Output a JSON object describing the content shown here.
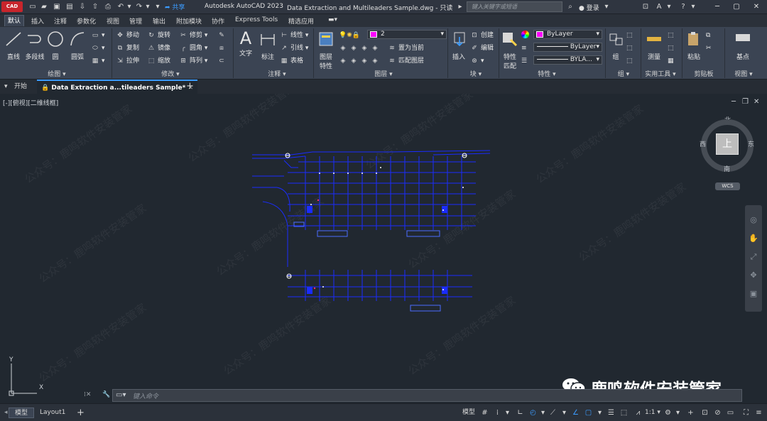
{
  "titlebar": {
    "logo_text": "CAD",
    "share_label": "共享",
    "app_title": "Autodesk AutoCAD 2023",
    "doc_title": "Data Extraction and Multileaders Sample.dwg - 只读",
    "search_placeholder": "键入关键字或短语",
    "login_label": "登录"
  },
  "ribbon_tabs": [
    "默认",
    "插入",
    "注释",
    "参数化",
    "视图",
    "管理",
    "输出",
    "附加模块",
    "协作",
    "Express Tools",
    "精选应用"
  ],
  "ribbon": {
    "draw": {
      "title": "绘图",
      "line": "直线",
      "polyline": "多段线",
      "circle": "圆",
      "arc": "圆弧"
    },
    "modify": {
      "title": "修改",
      "move": "移动",
      "rotate": "旋转",
      "trim": "修剪",
      "copy": "复制",
      "mirror": "镜像",
      "fillet": "圆角",
      "stretch": "拉伸",
      "scale": "缩放",
      "array": "阵列"
    },
    "annotation": {
      "title": "注释",
      "text": "文字",
      "dimension": "标注",
      "linear": "线性",
      "leader": "引线",
      "table": "表格"
    },
    "layers": {
      "title": "图层",
      "layer_props_line1": "图层",
      "layer_props_line2": "特性",
      "current_layer": "2",
      "make_current": "置为当前",
      "match_layer": "匹配图层"
    },
    "block": {
      "title": "块",
      "insert": "插入",
      "create": "创建",
      "edit": "编辑"
    },
    "properties": {
      "title": "特性",
      "match_line1": "特性",
      "match_line2": "匹配",
      "color": "ByLayer",
      "linetype": "ByLayer",
      "lineweight": "BYLA..."
    },
    "groups": {
      "title": "组",
      "group": "组"
    },
    "utilities": {
      "title": "实用工具",
      "measure": "测量"
    },
    "clipboard": {
      "title": "剪贴板",
      "paste": "粘贴"
    },
    "view": {
      "title": "视图",
      "base": "基点"
    }
  },
  "doc_tabs": {
    "start": "开始",
    "active": "Data Extraction a...tileaders Sample*"
  },
  "viewport": {
    "view_label": "[-][俯视][二维线框]",
    "viewcube_face": "上",
    "compass": {
      "north": "北",
      "south": "南",
      "east": "东",
      "west": "西"
    },
    "wcs": "WCS",
    "watermark": "公众号：鹿鸣软件安装管家",
    "brand_text": "鹿鸣软件安装管家",
    "ucs_x": "X",
    "ucs_y": "Y",
    "command_placeholder": "键入命令"
  },
  "statusbar": {
    "model_tab": "模型",
    "layout_tab": "Layout1",
    "model_space": "模型",
    "scale": "1:1"
  }
}
